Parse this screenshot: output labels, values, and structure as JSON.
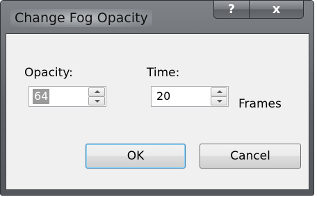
{
  "window": {
    "title": "Change Fog Opacity",
    "help_glyph": "?",
    "close_glyph": "x"
  },
  "opacity": {
    "label": "Opacity:",
    "value": "64"
  },
  "time": {
    "label": "Time:",
    "value": "20",
    "unit": "Frames"
  },
  "buttons": {
    "ok": "OK",
    "cancel": "Cancel"
  },
  "icons": {
    "help": "help-icon",
    "close": "close-icon",
    "spin_up": "chevron-up-icon",
    "spin_down": "chevron-down-icon"
  },
  "colors": {
    "title_frame": "#5e6266",
    "client_background": "#f0f0f0",
    "selected_value_background": "#9a9a9a",
    "default_button_border": "#3c7fb1"
  }
}
